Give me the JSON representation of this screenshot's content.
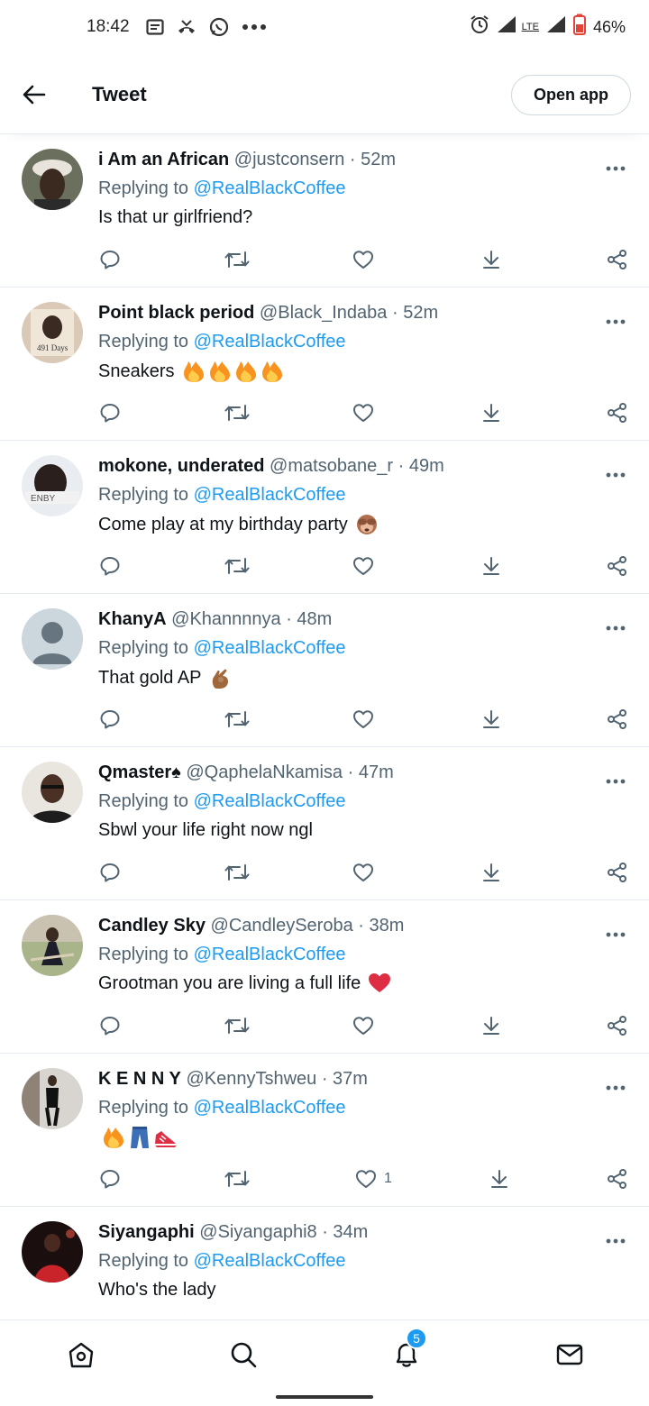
{
  "status_bar": {
    "time": "18:42",
    "network": "LTE",
    "battery": "46%",
    "icons": [
      "notes-icon",
      "missed-call-icon",
      "whatsapp-icon",
      "more-dots-icon",
      "alarm-icon",
      "signal-icon",
      "battery-low-icon"
    ]
  },
  "header": {
    "title": "Tweet",
    "open_app": "Open app"
  },
  "tweets": [
    {
      "name": "i Am an African",
      "handle": "@justconsern",
      "time": "· 52m",
      "replying_prefix": "Replying to",
      "replying_to": "@RealBlackCoffee",
      "text": "Is that ur girlfriend?",
      "emoji": [],
      "likes": ""
    },
    {
      "name": "Point black period",
      "handle": "@Black_Indaba",
      "time": "· 52m",
      "replying_prefix": "Replying to",
      "replying_to": "@RealBlackCoffee",
      "text": "Sneakers",
      "emoji": [
        "fire",
        "fire",
        "fire",
        "fire"
      ],
      "likes": ""
    },
    {
      "name": "mokone, underated",
      "handle": "@matsobane_r",
      "time": "· 49m",
      "replying_prefix": "Replying to",
      "replying_to": "@RealBlackCoffee",
      "text": "Come play at my birthday party",
      "emoji": [
        "see-no-evil"
      ],
      "likes": ""
    },
    {
      "name": "KhanyA",
      "handle": "@Khannnnya",
      "time": "· 48m",
      "replying_prefix": "Replying to",
      "replying_to": "@RealBlackCoffee",
      "text": "That gold AP",
      "emoji": [
        "ok-hand"
      ],
      "likes": ""
    },
    {
      "name": "Qmaster♠",
      "handle": "@QaphelaNkamisa",
      "time": "· 47m",
      "replying_prefix": "Replying to",
      "replying_to": "@RealBlackCoffee",
      "text": "Sbwl your life right now ngl",
      "emoji": [],
      "likes": ""
    },
    {
      "name": "Candley Sky",
      "handle": "@CandleySeroba",
      "time": "· 38m",
      "replying_prefix": "Replying to",
      "replying_to": "@RealBlackCoffee",
      "text": "Grootman you are living a full life",
      "emoji": [
        "red-heart"
      ],
      "likes": ""
    },
    {
      "name": "K E N N Y",
      "handle": "@KennyTshweu",
      "time": "· 37m",
      "replying_prefix": "Replying to",
      "replying_to": "@RealBlackCoffee",
      "text": "",
      "emoji": [
        "fire",
        "jeans",
        "sneaker"
      ],
      "likes": "1"
    },
    {
      "name": "Siyangaphi",
      "handle": "@Siyangaphi8",
      "time": "· 34m",
      "replying_prefix": "Replying to",
      "replying_to": "@RealBlackCoffee",
      "text": "Who's the lady",
      "emoji": [],
      "likes": ""
    }
  ],
  "bottom_nav": {
    "items": [
      "home-icon",
      "search-icon",
      "notifications-icon",
      "messages-icon"
    ],
    "notification_count": "5"
  },
  "colors": {
    "accent": "#1d9bf0",
    "text": "#0f1419",
    "secondary": "#536471",
    "border": "#e6ecf0",
    "battery_low": "#e0443a"
  }
}
